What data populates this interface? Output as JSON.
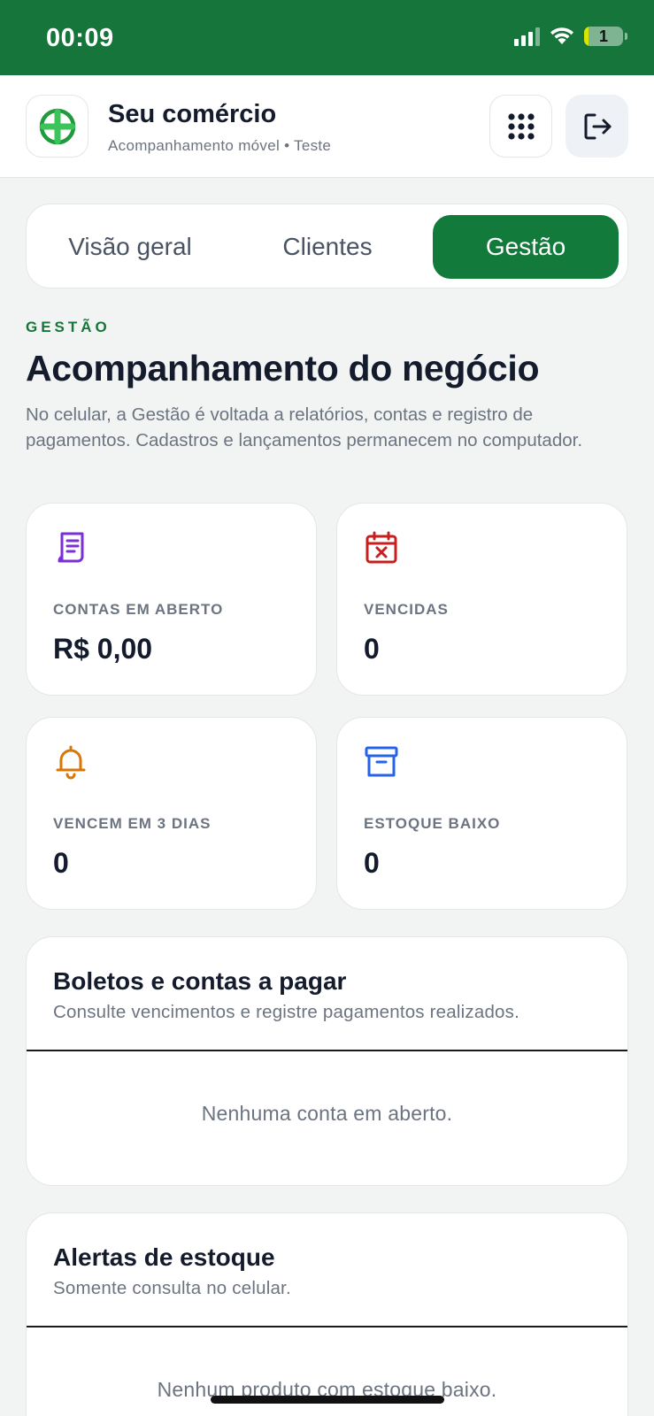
{
  "status_bar": {
    "time": "00:09",
    "battery": "1"
  },
  "header": {
    "title": "Seu comércio",
    "subtitle": "Acompanhamento móvel • Teste",
    "icons": {
      "logo": "plus-circle-icon",
      "menu": "grid-dots-icon",
      "logout": "logout-icon"
    }
  },
  "tabs": [
    {
      "label": "Visão geral",
      "active": false
    },
    {
      "label": "Clientes",
      "active": false
    },
    {
      "label": "Gestão",
      "active": true
    }
  ],
  "section": {
    "eyebrow": "GESTÃO",
    "title": "Acompanhamento do negócio",
    "description": "No celular, a Gestão é voltada a relatórios, contas e registro de pagamentos. Cadastros e lançamentos permanecem no computador."
  },
  "stats": [
    {
      "label": "CONTAS EM ABERTO",
      "value": "R$ 0,00",
      "icon": "receipt-icon",
      "color": "#7b2fd6"
    },
    {
      "label": "VENCIDAS",
      "value": "0",
      "icon": "calendar-x-icon",
      "color": "#c81e1e"
    },
    {
      "label": "VENCEM EM 3 DIAS",
      "value": "0",
      "icon": "bell-icon",
      "color": "#d97706"
    },
    {
      "label": "ESTOQUE BAIXO",
      "value": "0",
      "icon": "archive-box-icon",
      "color": "#2563eb"
    }
  ],
  "panels": [
    {
      "title": "Boletos e contas a pagar",
      "subtitle": "Consulte vencimentos e registre pagamentos realizados.",
      "empty": "Nenhuma conta em aberto."
    },
    {
      "title": "Alertas de estoque",
      "subtitle": "Somente consulta no celular.",
      "empty": "Nenhum produto com estoque baixo."
    }
  ],
  "colors": {
    "brand": "#16753a",
    "active_tab": "#127a3a"
  }
}
